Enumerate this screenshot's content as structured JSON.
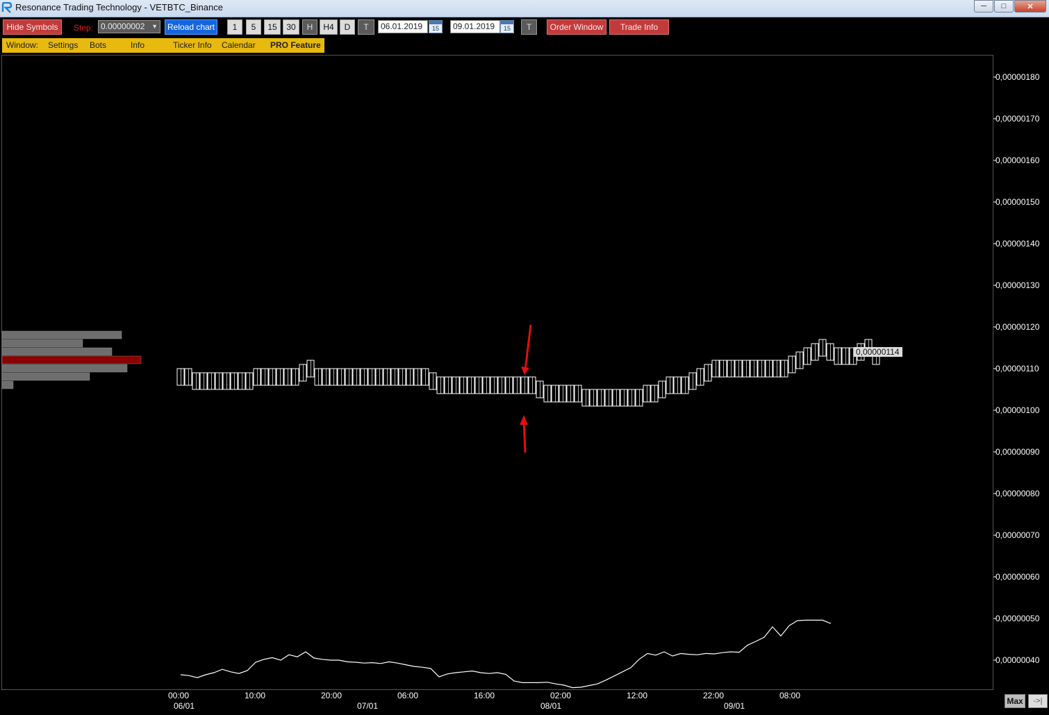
{
  "window": {
    "title": "Resonance Trading Technology - VETBTC_Binance"
  },
  "toolbar": {
    "hide_symbols": "Hide Symbols",
    "step_label": "Step:",
    "step_value": "0.00000002",
    "reload": "Reload chart",
    "timeframes": [
      "1",
      "5",
      "15",
      "30",
      "H",
      "H4",
      "D",
      "T"
    ],
    "active_timeframe": "H",
    "date_from": "06.01.2019",
    "date_to": "09.01.2019",
    "calendar_day": "15",
    "today_button": "T",
    "order_window": "Order Window",
    "trade_info": "Trade Info"
  },
  "menu": {
    "items": [
      "Window:",
      "Settings",
      "Bots",
      "Info",
      "Ticker Info",
      "Calendar",
      "PRO Feature"
    ]
  },
  "chart_data": {
    "type": "line",
    "y_axis_ticks": [
      "0,00000040",
      "0,00000050",
      "0,00000060",
      "0,00000070",
      "0,00000080",
      "0,00000090",
      "0,00000100",
      "0,00000110",
      "0,00000120",
      "0,00000130",
      "0,00000140",
      "0,00000150",
      "0,00000160",
      "0,00000170",
      "0,00000180"
    ],
    "y_values": [
      40,
      50,
      60,
      70,
      80,
      90,
      100,
      110,
      120,
      130,
      140,
      150,
      160,
      170,
      180
    ],
    "x_time_ticks": [
      "00:00",
      "10:00",
      "20:00",
      "06:00",
      "16:00",
      "02:00",
      "12:00",
      "22:00",
      "08:00"
    ],
    "x_date_ticks": [
      "06/01",
      "07/01",
      "08/01",
      "09/01"
    ],
    "current_price_label": "0,00000114",
    "current_price": 114,
    "price_series": [
      108,
      108,
      107,
      107,
      107,
      107,
      107,
      107,
      107,
      107,
      108,
      108,
      108,
      108,
      108,
      108,
      109,
      110,
      108,
      108,
      108,
      108,
      108,
      108,
      108,
      108,
      108,
      108,
      108,
      108,
      108,
      108,
      108,
      107,
      106,
      106,
      106,
      106,
      106,
      106,
      106,
      106,
      106,
      106,
      106,
      106,
      106,
      105,
      104,
      104,
      104,
      104,
      104,
      103,
      103,
      103,
      103,
      103,
      103,
      103,
      103,
      104,
      104,
      105,
      106,
      106,
      106,
      107,
      108,
      109,
      110,
      110,
      110,
      110,
      110,
      110,
      110,
      110,
      110,
      110,
      111,
      112,
      113,
      114,
      115,
      114,
      113,
      113,
      113,
      114,
      115,
      113
    ],
    "indicator_series": [
      36.5,
      36.3,
      35.8,
      36.5,
      37.0,
      37.8,
      37.2,
      36.8,
      37.5,
      39.5,
      40.2,
      40.6,
      40.0,
      41.3,
      40.8,
      42.0,
      40.5,
      40.2,
      40.0,
      40.0,
      39.6,
      39.5,
      39.3,
      39.4,
      39.2,
      39.6,
      39.3,
      38.9,
      38.5,
      38.3,
      38.0,
      36.0,
      36.7,
      37.0,
      37.2,
      37.4,
      37.0,
      36.8,
      37.0,
      36.6,
      35.0,
      34.6,
      34.6,
      34.6,
      34.7,
      34.3,
      34.0,
      33.4,
      33.5,
      33.9,
      34.3,
      35.2,
      36.2,
      37.2,
      38.2,
      40.2,
      41.6,
      41.2,
      42.0,
      41.0,
      41.6,
      41.4,
      41.3,
      41.6,
      41.5,
      41.8,
      42.0,
      41.9,
      43.6,
      44.5,
      45.5,
      48.0,
      45.8,
      48.3,
      49.5,
      49.6,
      49.6,
      49.6,
      48.8
    ],
    "volume_profile": [
      {
        "value": 118,
        "level": 0.86,
        "highlight": false
      },
      {
        "value": 116,
        "level": 0.58,
        "highlight": false
      },
      {
        "value": 114,
        "level": 0.79,
        "highlight": false
      },
      {
        "value": 112,
        "level": 1.0,
        "highlight": true
      },
      {
        "value": 110,
        "level": 0.9,
        "highlight": false
      },
      {
        "value": 108,
        "level": 0.63,
        "highlight": false
      },
      {
        "value": 106,
        "level": 0.08,
        "highlight": false
      }
    ],
    "colors": {
      "background": "#000000",
      "grid_text": "#ffffff",
      "profile": "#6e6e6e",
      "profile_highlight": "#8b0000",
      "annotation": "#e01010"
    }
  },
  "bottom_controls": {
    "max": "Max",
    "scroll": "->|"
  }
}
